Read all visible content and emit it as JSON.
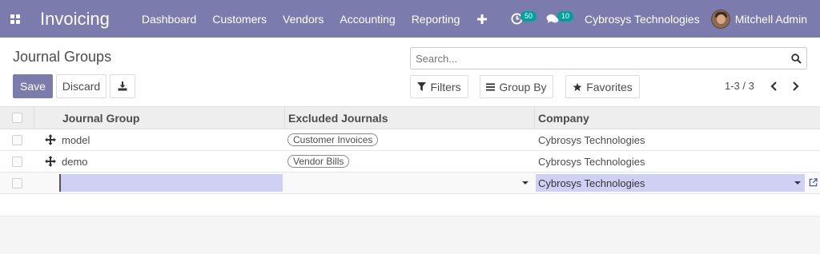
{
  "navbar": {
    "app_title": "Invoicing",
    "menu": [
      {
        "label": "Dashboard"
      },
      {
        "label": "Customers"
      },
      {
        "label": "Vendors"
      },
      {
        "label": "Accounting"
      },
      {
        "label": "Reporting"
      }
    ],
    "activity_count": "50",
    "messages_count": "10",
    "company": "Cybrosys Technologies",
    "user_name": "Mitchell Admin"
  },
  "control_panel": {
    "breadcrumb": "Journal Groups",
    "search_placeholder": "Search...",
    "save_label": "Save",
    "discard_label": "Discard",
    "filters_label": "Filters",
    "group_by_label": "Group By",
    "favorites_label": "Favorites",
    "pager": "1-3 / 3"
  },
  "table": {
    "columns": [
      "Journal Group",
      "Excluded Journals",
      "Company"
    ],
    "rows": [
      {
        "journal_group": "model",
        "excluded_journals": "Customer Invoices",
        "company": "Cybrosys Technologies"
      },
      {
        "journal_group": "demo",
        "excluded_journals": "Vendor Bills",
        "company": "Cybrosys Technologies"
      }
    ],
    "edit_row": {
      "journal_group": "",
      "excluded_journals": "",
      "company": "Cybrosys Technologies"
    }
  },
  "colors": {
    "brand": "#7c7bad",
    "badge": "#00a09d",
    "edit_highlight": "#d0d0f4"
  }
}
